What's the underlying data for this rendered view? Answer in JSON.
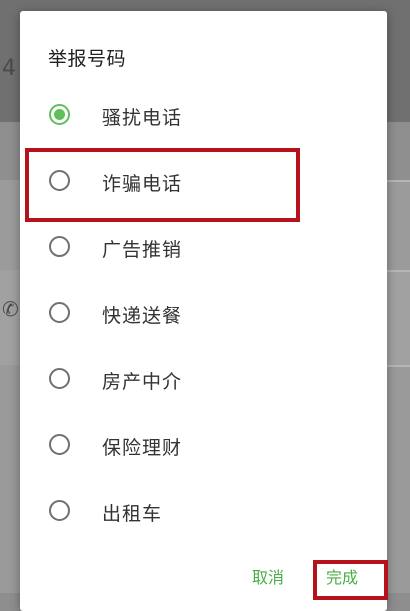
{
  "background": {
    "partial_digit": "4",
    "phone_icon": "phone-icon"
  },
  "dialog": {
    "title": "举报号码",
    "selected_index": 0,
    "options": [
      {
        "label": "骚扰电话",
        "checked": true
      },
      {
        "label": "诈骗电话",
        "checked": false
      },
      {
        "label": "广告推销",
        "checked": false
      },
      {
        "label": "快递送餐",
        "checked": false
      },
      {
        "label": "房产中介",
        "checked": false
      },
      {
        "label": "保险理财",
        "checked": false
      },
      {
        "label": "出租车",
        "checked": false
      }
    ],
    "cancel_label": "取消",
    "done_label": "完成"
  },
  "colors": {
    "accent": "#5fbf5b",
    "button_text": "#4aad45",
    "highlight": "#b5121b",
    "scrim": "#8e8e8e"
  }
}
